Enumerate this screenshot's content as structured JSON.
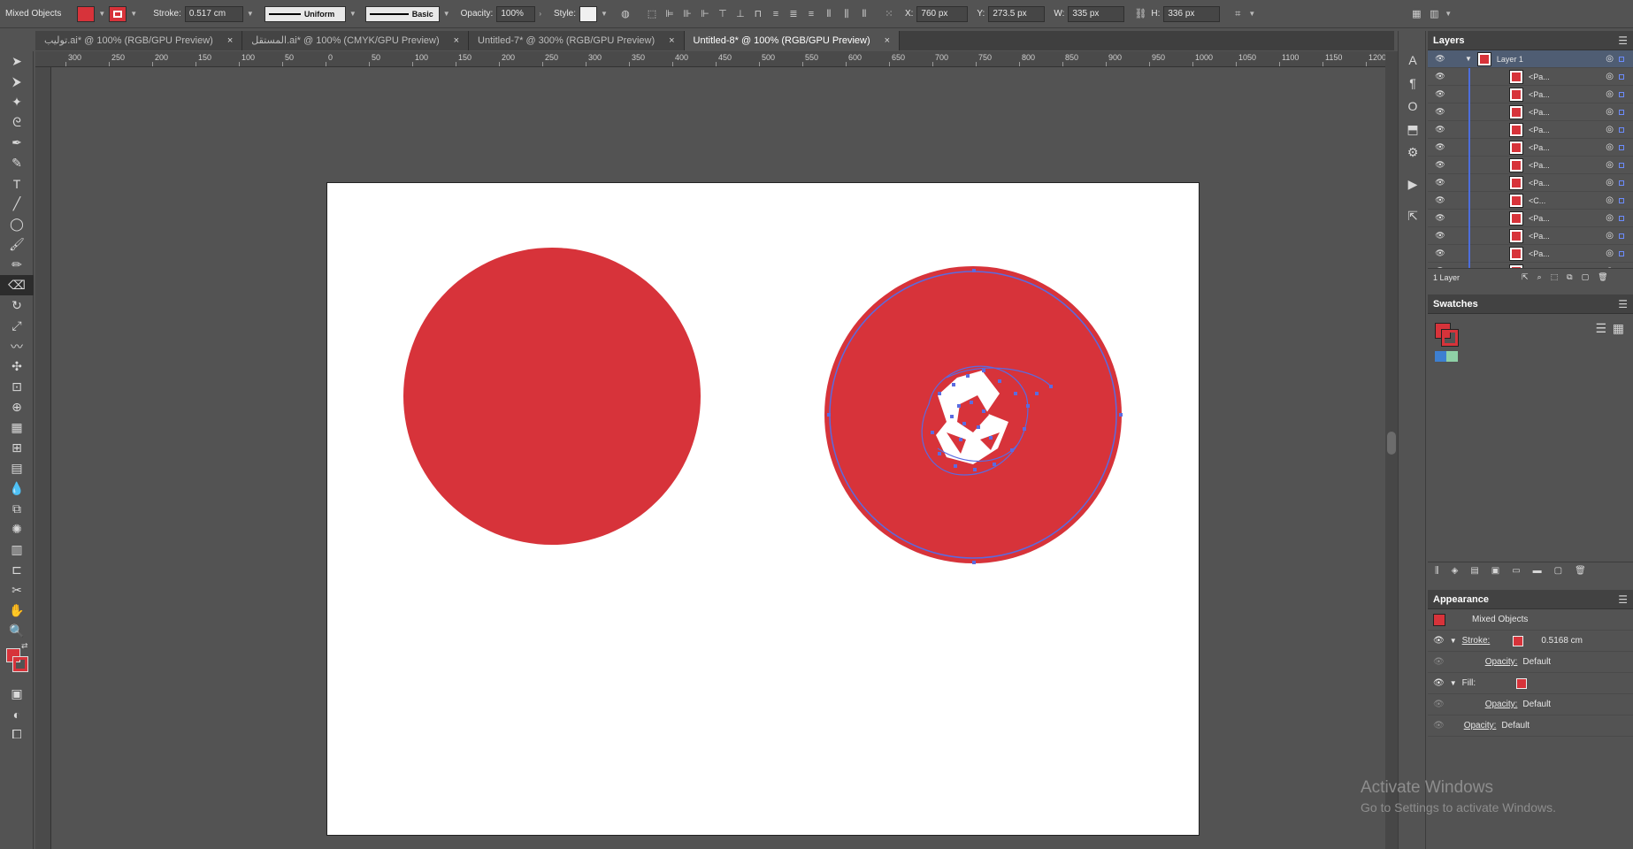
{
  "control_bar": {
    "selection_label": "Mixed Objects",
    "fill_color": "#d7333a",
    "stroke_label": "Stroke:",
    "stroke_weight": "0.517 cm",
    "profile_label": "Uniform",
    "brush_label": "Basic",
    "opacity_label": "Opacity:",
    "opacity_value": "100%",
    "style_label": "Style:",
    "x_label": "X:",
    "x_value": "760 px",
    "y_label": "Y:",
    "y_value": "273.5 px",
    "w_label": "W:",
    "w_value": "335 px",
    "h_label": "H:",
    "h_value": "336 px"
  },
  "tabs": [
    {
      "label": "توليب.ai* @ 100% (RGB/GPU Preview)",
      "active": false
    },
    {
      "label": "المستقل.ai* @ 100% (CMYK/GPU Preview)",
      "active": false
    },
    {
      "label": "Untitled-7* @ 300% (RGB/GPU Preview)",
      "active": false
    },
    {
      "label": "Untitled-8* @ 100% (RGB/GPU Preview)",
      "active": true
    }
  ],
  "ruler_labels": [
    "300",
    "250",
    "200",
    "150",
    "100",
    "50",
    "0",
    "50",
    "100",
    "150",
    "200",
    "250",
    "300",
    "350",
    "400",
    "450",
    "500",
    "550",
    "600",
    "650",
    "700",
    "750",
    "800",
    "850",
    "900",
    "950",
    "1000",
    "1050",
    "1100",
    "1150",
    "1200"
  ],
  "colors": {
    "accent_red": "#d7333a",
    "path_blue": "#5b6be0",
    "artboard": "#ffffff"
  },
  "panels": {
    "layers": {
      "title": "Layers",
      "parent_layer": "Layer 1",
      "children": [
        "<Pa...",
        "<Pa...",
        "<Pa...",
        "<Pa...",
        "<Pa...",
        "<Pa...",
        "<Pa...",
        "<C...",
        "<Pa...",
        "<Pa...",
        "<Pa...",
        "<Pa..."
      ],
      "footer_count": "1 Layer"
    },
    "swatches": {
      "title": "Swatches"
    },
    "appearance": {
      "title": "Appearance",
      "object_label": "Mixed Objects",
      "stroke_label": "Stroke:",
      "stroke_value": "0.5168 cm",
      "opacity_label": "Opacity:",
      "opacity_value": "Default",
      "fill_label": "Fill:",
      "fill_opacity_label": "Opacity:",
      "fill_opacity_value": "Default",
      "object_opacity_label": "Opacity:",
      "object_opacity_value": "Default"
    }
  },
  "watermark": {
    "title": "Activate Windows",
    "subtitle": "Go to Settings to activate Windows."
  }
}
